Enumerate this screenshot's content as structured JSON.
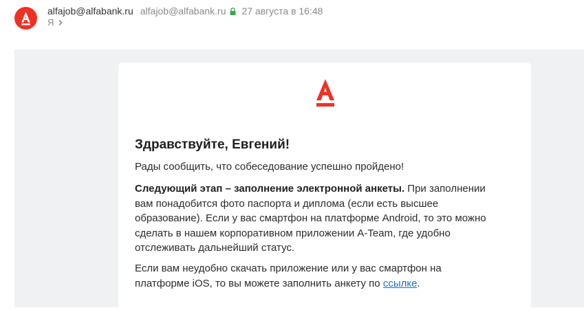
{
  "header": {
    "sender_name": "alfajob@alfabank.ru",
    "sender_email": "alfajob@alfabank.ru",
    "lock_icon": "lock-icon",
    "date": "27 августа в 16:48",
    "recipient": "Я",
    "avatar_letter": "А",
    "avatar_color": "#ef3124"
  },
  "email": {
    "brand_color": "#ef3124",
    "greeting": "Здравствуйте, Евгений!",
    "para1": "Рады сообщить, что собеседование успешно пройдено!",
    "para2_bold": "Следующий этап – заполнение электронной анкеты.",
    "para2_line1_rest": " При заполнении",
    "para2_line2": "вам понадобится фото паспорта и диплома (если есть высшее",
    "para2_line3": "образование). Если у вас смартфон на платформе Android, то это можно",
    "para2_line4": "сделать в нашем корпоративном приложении A-Team, где удобно",
    "para2_line5": "отслеживать дальнейший статус.",
    "para3_line1": "Если вам неудобно скачать приложение или у вас смартфон на",
    "para3_line2_pre": "платформе iOS, то вы можете заполнить анкету по ",
    "para3_link": "ссылке",
    "para3_end": "."
  }
}
